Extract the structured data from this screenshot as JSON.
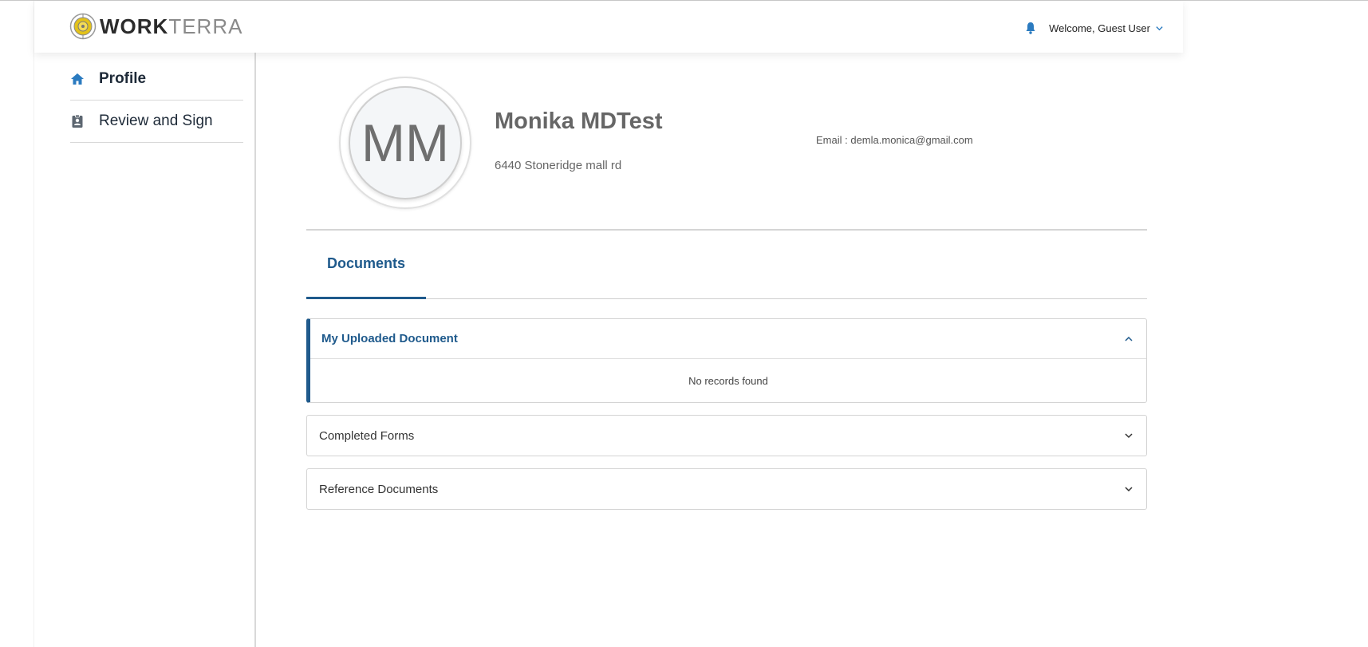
{
  "brand": {
    "work": "WORK",
    "terra": "TERRA"
  },
  "header": {
    "welcome": "Welcome, Guest User"
  },
  "sidebar": {
    "items": [
      {
        "label": "Profile",
        "icon": "home-icon",
        "active": true
      },
      {
        "label": "Review and Sign",
        "icon": "id-badge-icon",
        "active": false
      }
    ]
  },
  "profile": {
    "initials": "MM",
    "name": "Monika MDTest",
    "address": "6440 Stoneridge mall rd",
    "email": "Email : demla.monica@gmail.com"
  },
  "tabs": [
    {
      "label": "Documents",
      "active": true
    }
  ],
  "accordions": [
    {
      "title": "My Uploaded Document",
      "expanded": true,
      "empty_text": "No records found"
    },
    {
      "title": "Completed Forms",
      "expanded": false
    },
    {
      "title": "Reference Documents",
      "expanded": false
    }
  ],
  "colors": {
    "accent": "#1f5a8c",
    "icon_blue": "#2b7bc0",
    "logo_yellow": "#e3c21a"
  }
}
